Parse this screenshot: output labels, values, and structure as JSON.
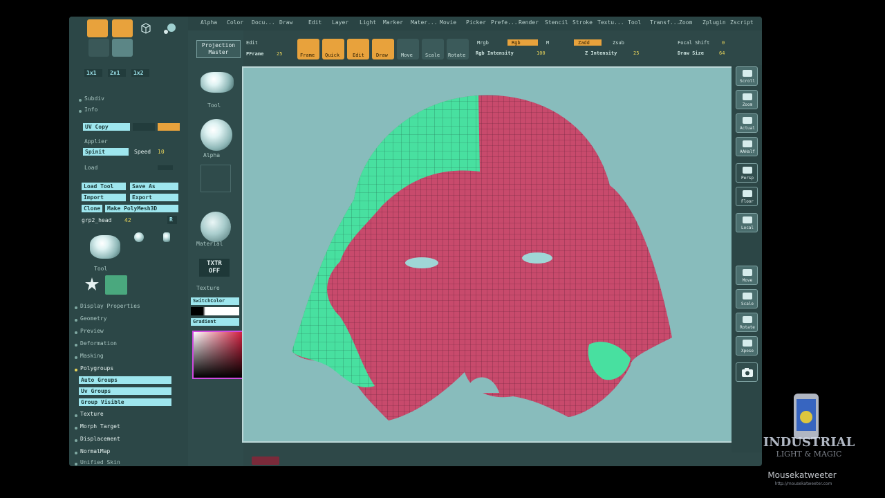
{
  "menu": [
    "Alpha",
    "Color",
    "Docu...",
    "Draw",
    "Edit",
    "Layer",
    "Light",
    "Marker",
    "Mater...",
    "Movie",
    "Picker",
    "Prefe...",
    "Render",
    "Stencil",
    "Stroke",
    "Textu...",
    "Tool",
    "Transf...",
    "Zoom",
    "Zplugin",
    "Zscript"
  ],
  "left_panel": {
    "top_buttons": [
      "Quick",
      "Frame"
    ],
    "rows": [
      "Subdiv",
      "Info"
    ],
    "uv_copy": "UV Copy",
    "applier": "Applier",
    "spinit": "Spinit",
    "speed_label": "Speed",
    "speed_value": "10",
    "load": "Load",
    "load_tool": "Load Tool",
    "save_as": "Save As",
    "import": "Import",
    "export": "Export",
    "clone": "Clone",
    "make_poly": "Make PolyMesh3D",
    "tool_name": "grp2_head",
    "tool_count": "42",
    "tool_label": "Tool",
    "sections": [
      "Display Properties",
      "Geometry",
      "Preview",
      "Deformation",
      "Masking",
      "Polygroups"
    ],
    "auto_groups": "Auto Groups",
    "uv_groups": "Uv Groups",
    "group_visible": "Group Visible",
    "sections2": [
      "Texture",
      "Morph Target",
      "Displacement",
      "NormalMap",
      "Unified Skin"
    ]
  },
  "mid_panel": {
    "tool": "Tool",
    "alpha": "Alpha",
    "material": "Material",
    "txtr_line1": "TXTR",
    "txtr_line2": "OFF",
    "texture": "Texture",
    "switch_color": "SwitchColor",
    "gradient": "Gradient"
  },
  "toolbar": {
    "projection_line1": "Projection",
    "projection_line2": "Master",
    "edit": "Edit",
    "pframe_label": "PFrame",
    "pframe_value": "25",
    "buttons": [
      "Frame",
      "Quick",
      "Edit",
      "Draw",
      "Move",
      "Scale",
      "Rotate"
    ],
    "mrgb": "Mrgb",
    "rgb": "Rgb",
    "m": "M",
    "zadd": "Zadd",
    "zsub": "Zsub",
    "rgb_intensity_label": "Rgb Intensity",
    "rgb_intensity_value": "100",
    "z_intensity_label": "Z Intensity",
    "z_intensity_value": "25",
    "focal_shift_label": "Focal Shift",
    "focal_shift_value": "0",
    "draw_size_label": "Draw Size",
    "draw_size_value": "64"
  },
  "right_panel": [
    "Scroll",
    "Zoom",
    "Actual",
    "AAHalf",
    "Persp",
    "Floor",
    "Local",
    "Move",
    "Scale",
    "Rotate",
    "Xpose",
    ""
  ],
  "colors": {
    "accent": "#e8a23c",
    "canvas": "#88bcbc",
    "mesh_pink": "#c84a6c",
    "mesh_green": "#48e0a0",
    "field": "#9ee6ee"
  },
  "watermark": {
    "line1": "INDUSTRIAL",
    "line2": "LIGHT & MAGIC",
    "site": "Mousekatweeter",
    "url": "http://mousekatweeter.com"
  }
}
